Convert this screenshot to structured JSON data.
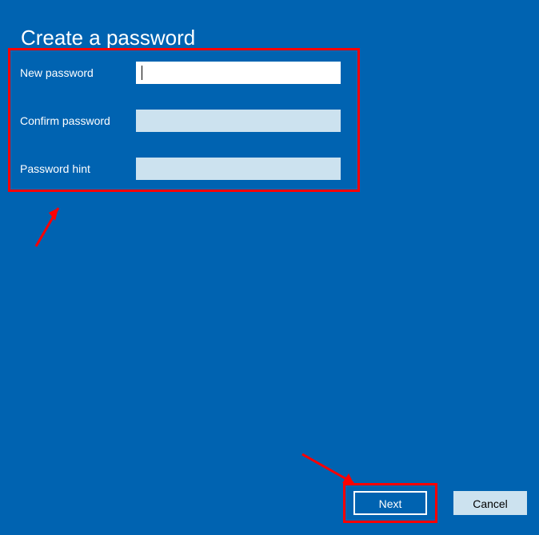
{
  "title": "Create a password",
  "form": {
    "new_password": {
      "label": "New password",
      "value": ""
    },
    "confirm_password": {
      "label": "Confirm password",
      "value": ""
    },
    "password_hint": {
      "label": "Password hint",
      "value": ""
    }
  },
  "buttons": {
    "next": "Next",
    "cancel": "Cancel"
  },
  "colors": {
    "background": "#0063B1",
    "highlight": "#ff0000",
    "inactive_input": "#cce2ef"
  }
}
